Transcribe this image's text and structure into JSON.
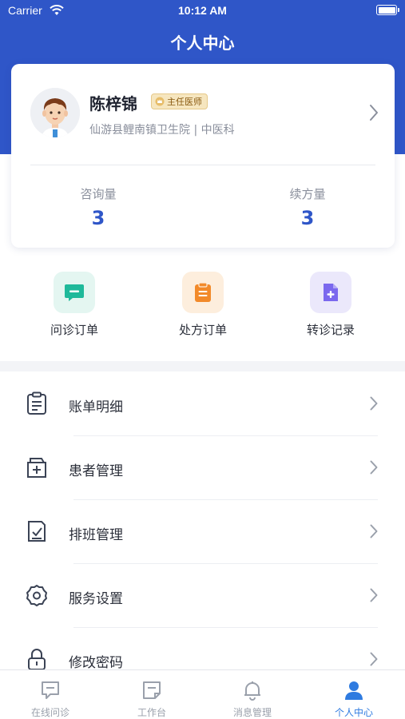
{
  "status_bar": {
    "carrier": "Carrier",
    "time": "10:12 AM"
  },
  "nav": {
    "title": "个人中心"
  },
  "profile": {
    "name": "陈梓锦",
    "badge": "主任医师",
    "hospital": "仙游县鲤南镇卫生院 | 中医科",
    "stats": [
      {
        "label": "咨询量",
        "value": "3"
      },
      {
        "label": "续方量",
        "value": "3"
      }
    ]
  },
  "quick_actions": [
    {
      "label": "问诊订单",
      "icon": "chat-icon",
      "color": "#1fb99a"
    },
    {
      "label": "处方订单",
      "icon": "clipboard-icon",
      "color": "#f28a2a"
    },
    {
      "label": "转诊记录",
      "icon": "file-add-icon",
      "color": "#7b68ee"
    }
  ],
  "menu": [
    {
      "label": "账单明细",
      "icon": "bill-icon"
    },
    {
      "label": "患者管理",
      "icon": "patient-folder-icon"
    },
    {
      "label": "排班管理",
      "icon": "schedule-icon"
    },
    {
      "label": "服务设置",
      "icon": "settings-gear-icon"
    },
    {
      "label": "修改密码",
      "icon": "lock-icon"
    }
  ],
  "tabs": [
    {
      "label": "在线问诊",
      "icon": "consult-icon",
      "active": false
    },
    {
      "label": "工作台",
      "icon": "workbench-icon",
      "active": false
    },
    {
      "label": "消息管理",
      "icon": "bell-icon",
      "active": false
    },
    {
      "label": "个人中心",
      "icon": "person-icon",
      "active": true
    }
  ],
  "colors": {
    "primary": "#2f56c8",
    "tab_active": "#2f7be0"
  }
}
